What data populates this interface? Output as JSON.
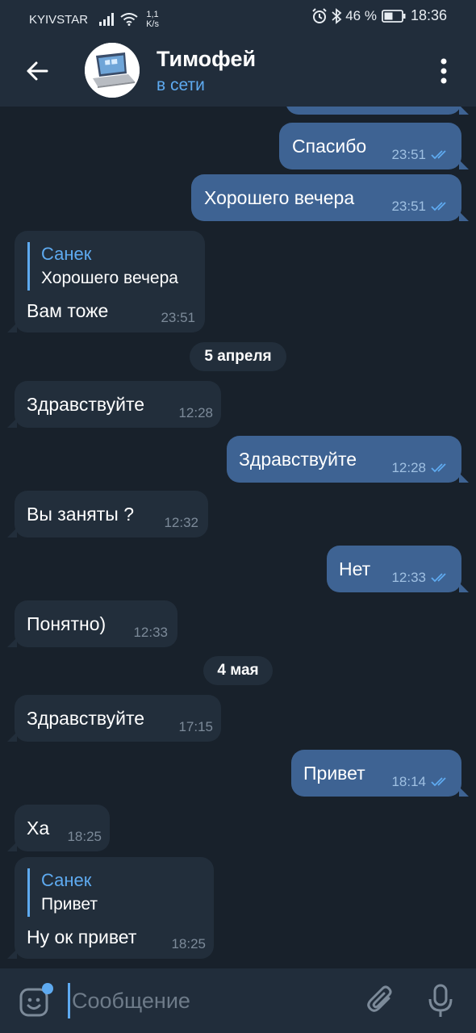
{
  "status_bar": {
    "carrier": "KYIVSTAR",
    "speed_value": "1,1",
    "speed_unit": "K/s",
    "battery": "46 %",
    "time": "18:36"
  },
  "header": {
    "title": "Тимофей",
    "status": "в сети",
    "icons": [
      "back-arrow-icon",
      "more-vertical-icon"
    ]
  },
  "messages": [
    {
      "dir": "out",
      "text": "Спасибо",
      "time": "23:51",
      "read": true
    },
    {
      "dir": "out",
      "text": "Хорошего вечера",
      "time": "23:51",
      "read": true
    },
    {
      "dir": "in",
      "reply_name": "Санек",
      "reply_text": "Хорошего вечера",
      "text": "Вам тоже",
      "time": "23:51"
    },
    {
      "date": "5 апреля"
    },
    {
      "dir": "in",
      "text": "Здравствуйте",
      "time": "12:28"
    },
    {
      "dir": "out",
      "text": "Здравствуйте",
      "time": "12:28",
      "read": true
    },
    {
      "dir": "in",
      "text": "Вы заняты ?",
      "time": "12:32"
    },
    {
      "dir": "out",
      "text": "Нет",
      "time": "12:33",
      "read": true
    },
    {
      "dir": "in",
      "text": "Понятно)",
      "time": "12:33"
    },
    {
      "date": "4 мая"
    },
    {
      "dir": "in",
      "text": "Здравствуйте",
      "time": "17:15"
    },
    {
      "dir": "out",
      "text": "Привет",
      "time": "18:14",
      "read": true
    },
    {
      "dir": "in",
      "text": "Ха",
      "time": "18:25"
    },
    {
      "dir": "in",
      "reply_name": "Санек",
      "reply_text": "Привет",
      "text": "Ну ок привет",
      "time": "18:25"
    }
  ],
  "composer": {
    "placeholder": "Сообщение",
    "icons": [
      "emoji-icon",
      "attach-icon",
      "microphone-icon"
    ]
  },
  "colors": {
    "background": "#18212b",
    "header": "#212d3b",
    "outgoing_bubble": "#3e6393",
    "incoming_bubble": "#222e3b",
    "accent": "#5eaaf0"
  }
}
